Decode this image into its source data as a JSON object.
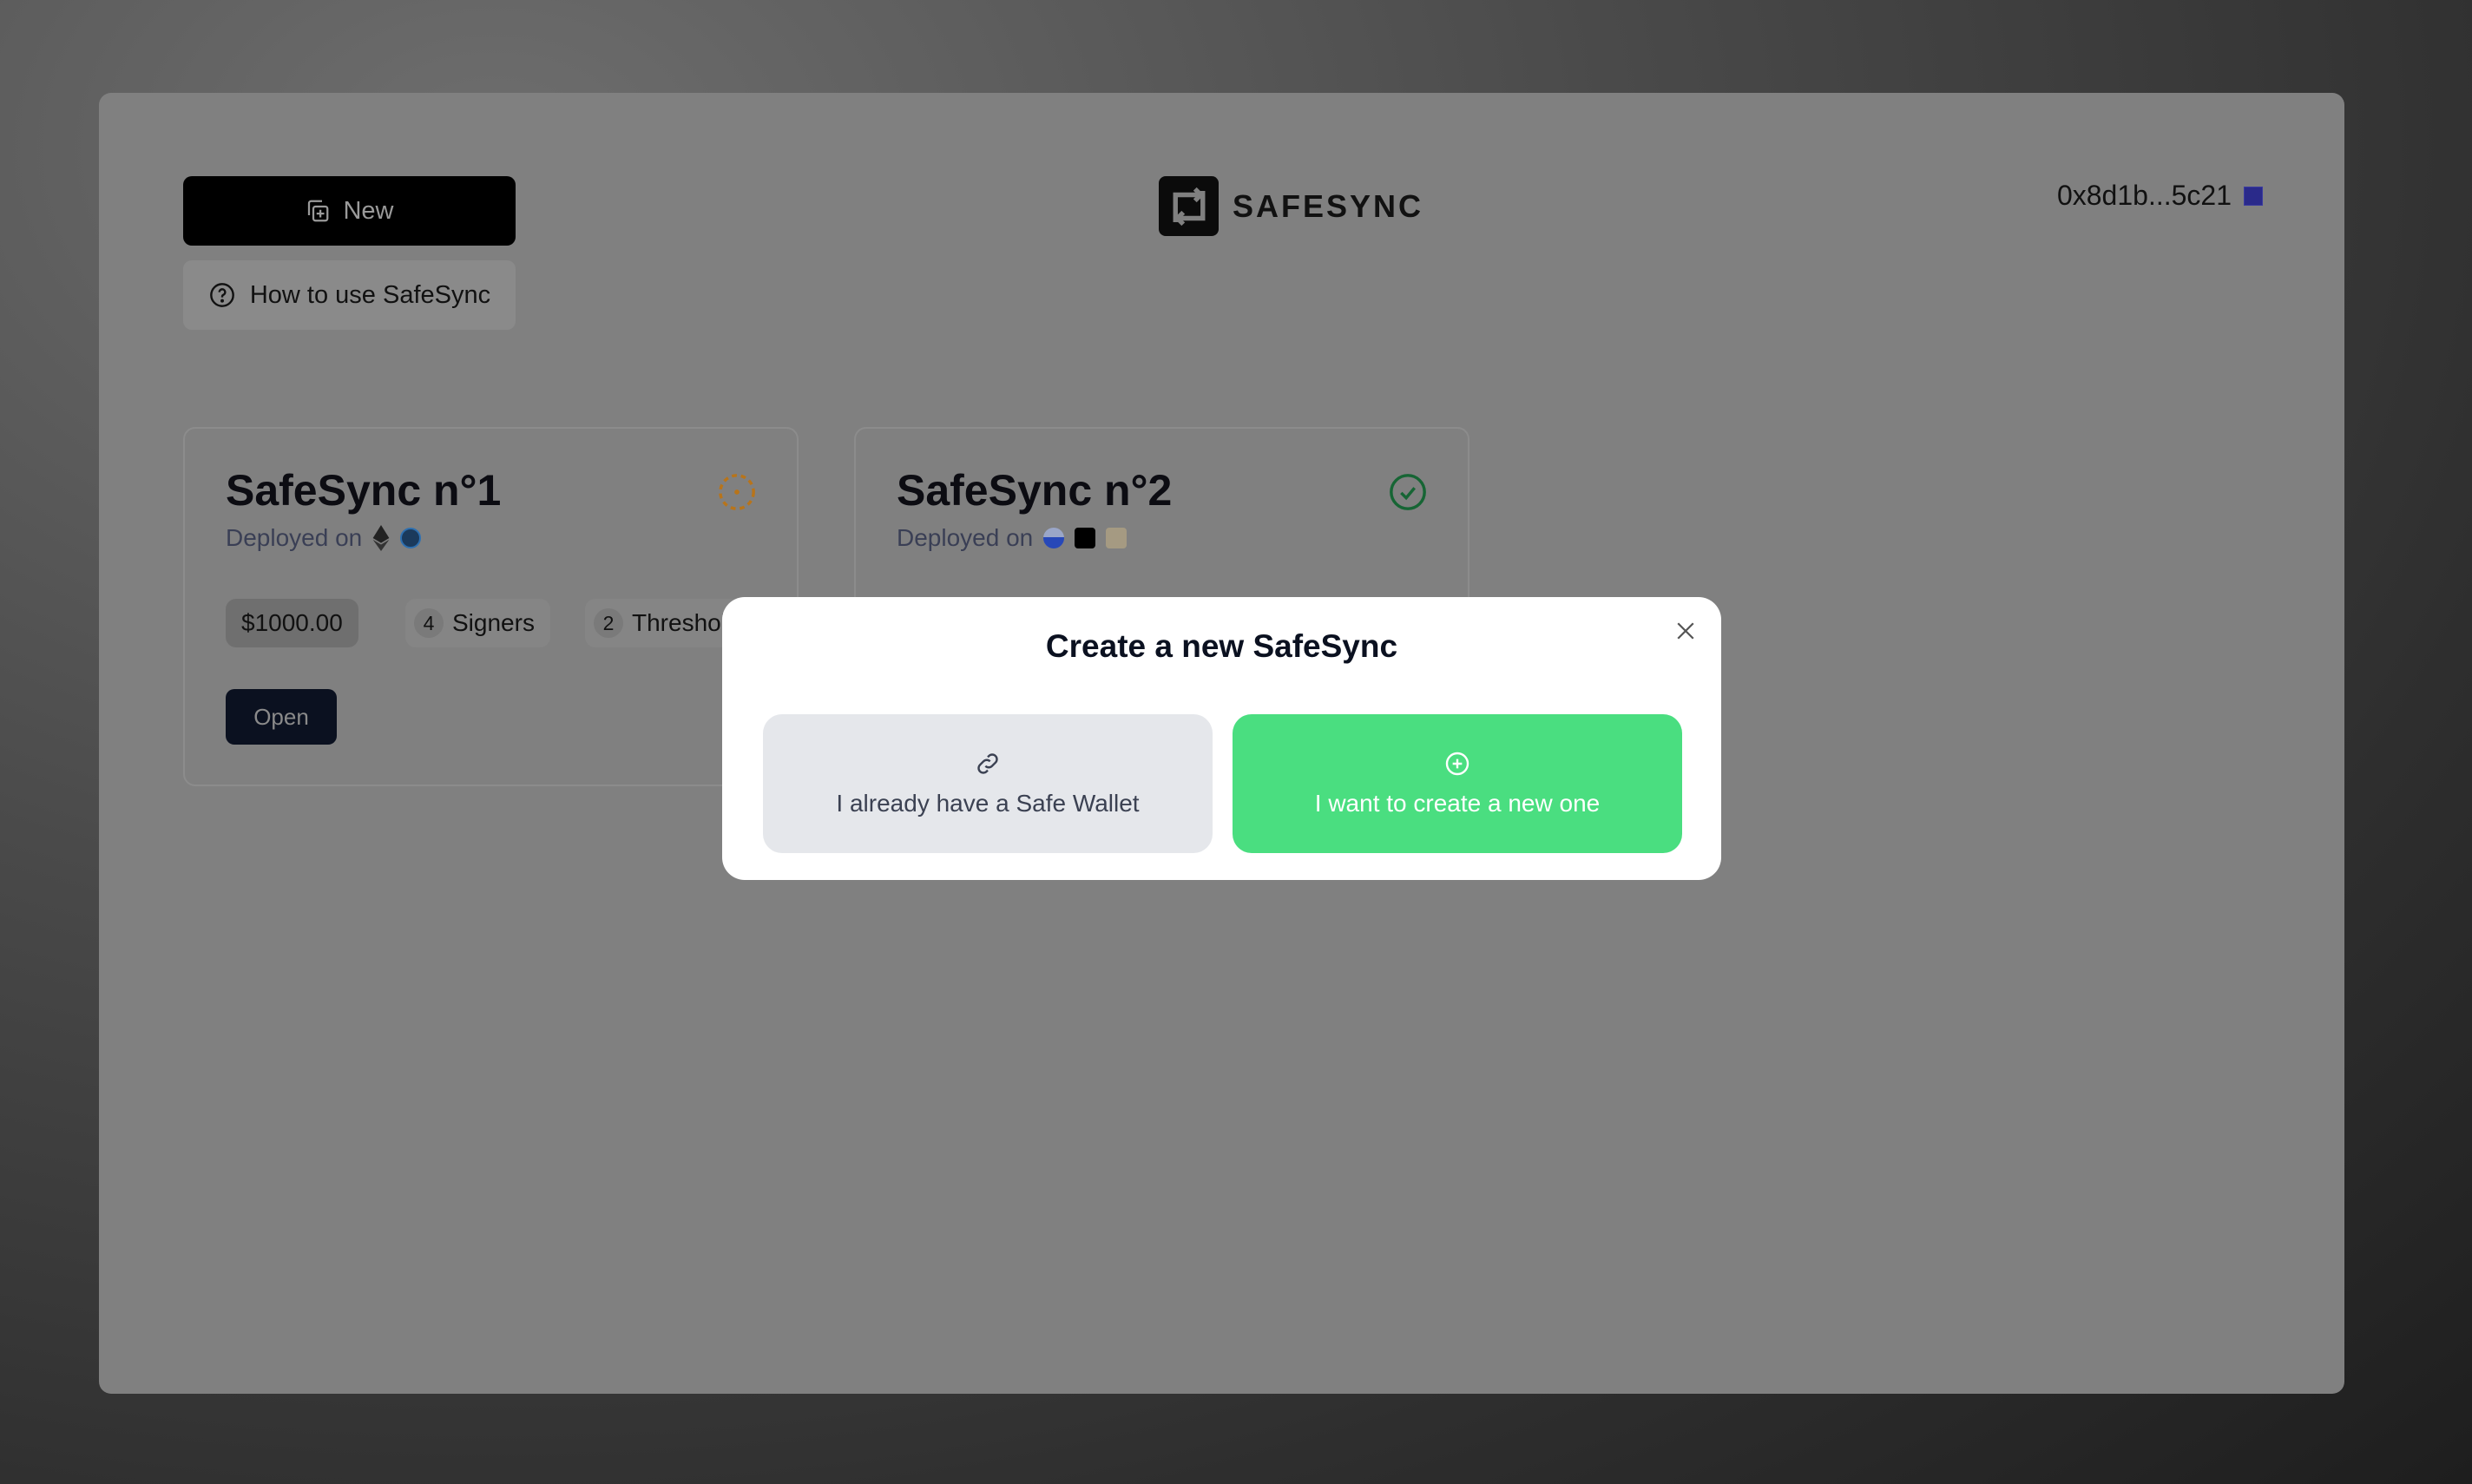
{
  "header": {
    "new_label": "New",
    "help_label": "How to use SafeSync",
    "brand": "SAFESYNC",
    "address": "0x8d1b...5c21"
  },
  "cards": [
    {
      "title": "SafeSync n°1",
      "deployed_label": "Deployed on",
      "chains": [
        "ethereum",
        "arbitrum"
      ],
      "status": "pending",
      "balance": "$1000.00",
      "signers_count": "4",
      "signers_label": "Signers",
      "threshold_count": "2",
      "threshold_label": "Threshold",
      "open_label": "Open"
    },
    {
      "title": "SafeSync n°2",
      "deployed_label": "Deployed on",
      "chains": [
        "base",
        "linea",
        "scroll"
      ],
      "status": "deployed"
    }
  ],
  "modal": {
    "title": "Create a new SafeSync",
    "existing_label": "I already have a Safe Wallet",
    "new_label": "I want to create a new one"
  },
  "colors": {
    "accent_green": "#4ade80",
    "pending": "#b8741a",
    "success": "#166534"
  }
}
